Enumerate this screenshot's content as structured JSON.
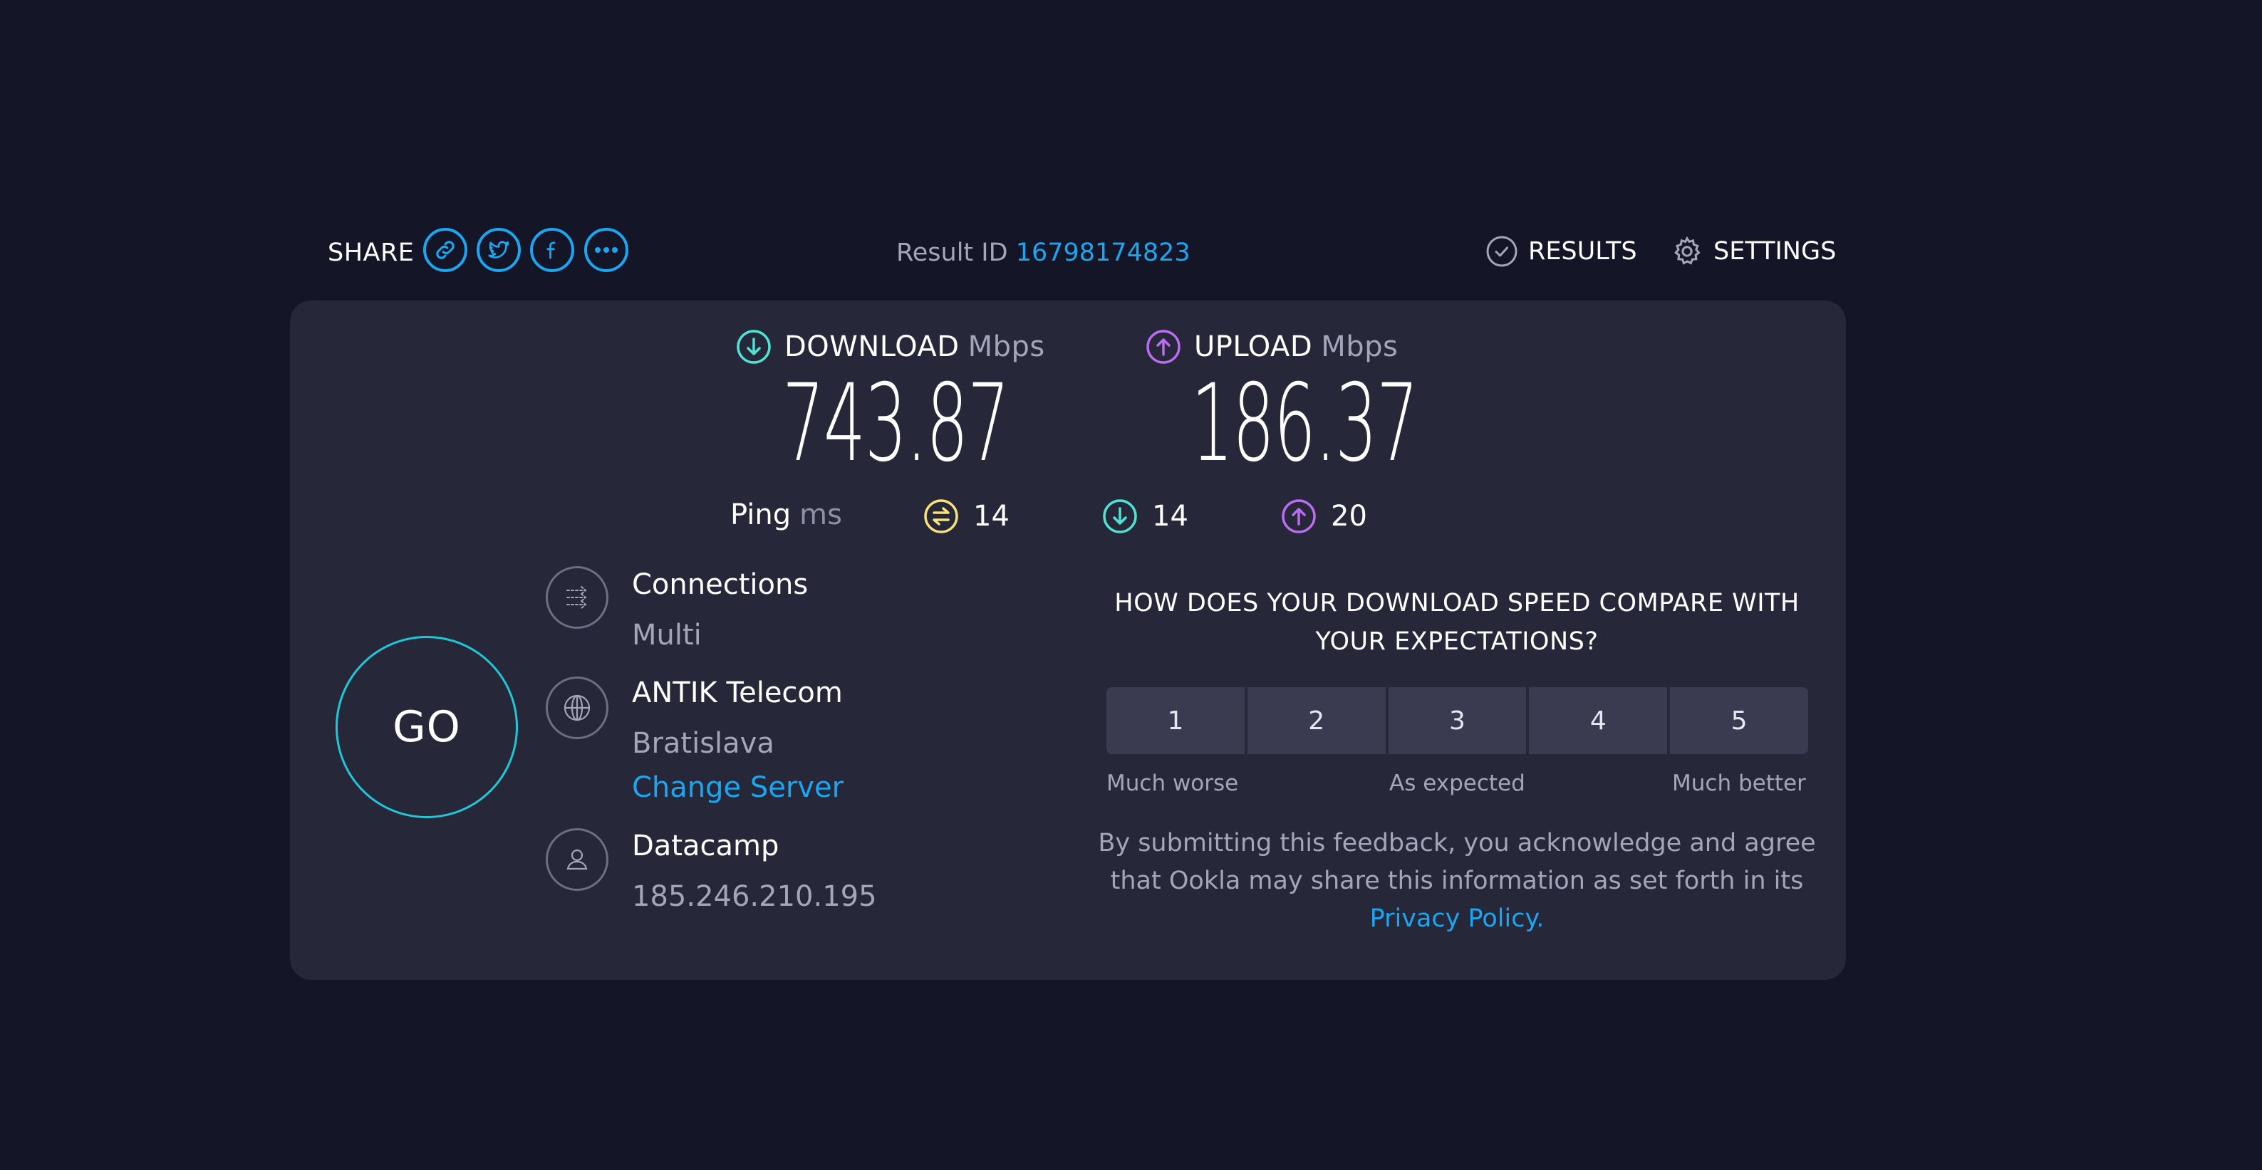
{
  "header": {
    "share_label": "SHARE",
    "share_buttons": [
      {
        "icon": "link-icon"
      },
      {
        "icon": "twitter-icon"
      },
      {
        "icon": "facebook-icon"
      },
      {
        "icon": "more-icon"
      }
    ],
    "result_id_label": "Result ID",
    "result_id_value": "16798174823",
    "results_label": "RESULTS",
    "settings_label": "SETTINGS"
  },
  "metrics": {
    "download": {
      "label": "DOWNLOAD",
      "unit": "Mbps",
      "value": "743.87",
      "color": "#4fe3d6"
    },
    "upload": {
      "label": "UPLOAD",
      "unit": "Mbps",
      "value": "186.37",
      "color": "#bb6cf0"
    }
  },
  "ping": {
    "label": "Ping",
    "unit": "ms",
    "idle": {
      "value": "14",
      "color": "#f7e27a"
    },
    "download": {
      "value": "14",
      "color": "#4fe3d6"
    },
    "upload": {
      "value": "20",
      "color": "#bb6cf0"
    }
  },
  "go_button": {
    "label": "GO",
    "color": "#1ec8d8"
  },
  "connection_info": {
    "connections": {
      "title": "Connections",
      "value": "Multi"
    },
    "server": {
      "title": "ANTIK Telecom",
      "location": "Bratislava",
      "change_label": "Change Server"
    },
    "host": {
      "title": "Datacamp",
      "ip": "185.246.210.195"
    }
  },
  "survey": {
    "question_line1": "HOW DOES YOUR DOWNLOAD SPEED COMPARE WITH",
    "question_line2": "YOUR EXPECTATIONS?",
    "options": [
      "1",
      "2",
      "3",
      "4",
      "5"
    ],
    "scale_low": "Much worse",
    "scale_mid": "As expected",
    "scale_high": "Much better",
    "disclaimer_line1": "By submitting this feedback, you acknowledge and agree",
    "disclaimer_line2": "that Ookla may share this information as set forth in its",
    "privacy_link": "Privacy Policy."
  },
  "colors": {
    "background": "#141526",
    "card": "#262739",
    "accent": "#1aa6f0"
  }
}
